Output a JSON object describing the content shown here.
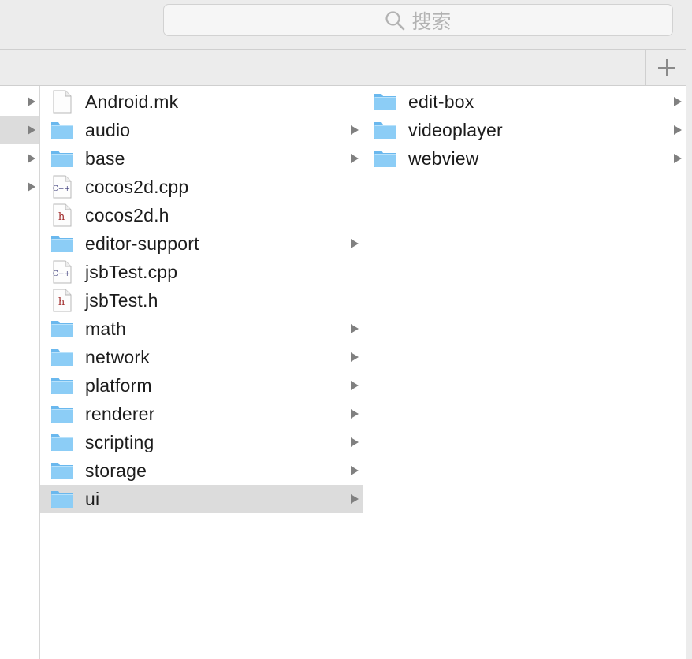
{
  "search": {
    "placeholder": "搜索"
  },
  "sidebar_rows": [
    {
      "has_arrow": true,
      "selected": false
    },
    {
      "has_arrow": true,
      "selected": true
    },
    {
      "has_arrow": true,
      "selected": false
    },
    {
      "has_arrow": true,
      "selected": false
    }
  ],
  "column2": {
    "items": [
      {
        "name": "Android.mk",
        "type": "file-plain",
        "has_arrow": false,
        "selected": false
      },
      {
        "name": "audio",
        "type": "folder",
        "has_arrow": true,
        "selected": false
      },
      {
        "name": "base",
        "type": "folder",
        "has_arrow": true,
        "selected": false
      },
      {
        "name": "cocos2d.cpp",
        "type": "file-cpp",
        "has_arrow": false,
        "selected": false
      },
      {
        "name": "cocos2d.h",
        "type": "file-h",
        "has_arrow": false,
        "selected": false
      },
      {
        "name": "editor-support",
        "type": "folder",
        "has_arrow": true,
        "selected": false
      },
      {
        "name": "jsbTest.cpp",
        "type": "file-cpp",
        "has_arrow": false,
        "selected": false
      },
      {
        "name": "jsbTest.h",
        "type": "file-h",
        "has_arrow": false,
        "selected": false
      },
      {
        "name": "math",
        "type": "folder",
        "has_arrow": true,
        "selected": false
      },
      {
        "name": "network",
        "type": "folder",
        "has_arrow": true,
        "selected": false
      },
      {
        "name": "platform",
        "type": "folder",
        "has_arrow": true,
        "selected": false
      },
      {
        "name": "renderer",
        "type": "folder",
        "has_arrow": true,
        "selected": false
      },
      {
        "name": "scripting",
        "type": "folder",
        "has_arrow": true,
        "selected": false
      },
      {
        "name": "storage",
        "type": "folder",
        "has_arrow": true,
        "selected": false
      },
      {
        "name": "ui",
        "type": "folder",
        "has_arrow": true,
        "selected": true
      }
    ]
  },
  "column3": {
    "items": [
      {
        "name": "edit-box",
        "type": "folder",
        "has_arrow": true,
        "selected": false
      },
      {
        "name": "videoplayer",
        "type": "folder",
        "has_arrow": true,
        "selected": false
      },
      {
        "name": "webview",
        "type": "folder",
        "has_arrow": true,
        "selected": false
      }
    ]
  },
  "colors": {
    "folder": "#8ccdf6",
    "folder_dark": "#6ab8ee",
    "selection": "#dcdcdc",
    "chrome": "#ececec",
    "arrow": "#808080"
  }
}
